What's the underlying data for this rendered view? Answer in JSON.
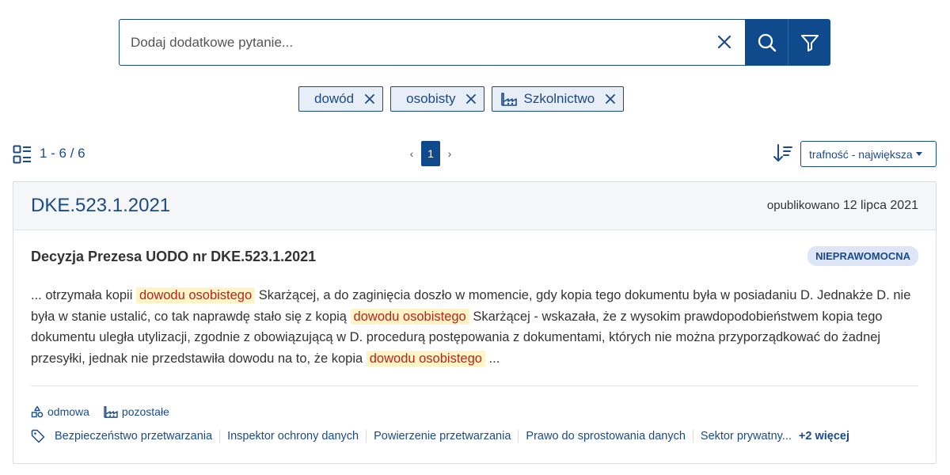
{
  "search": {
    "placeholder": "Dodaj dodatkowe pytanie...",
    "value": ""
  },
  "chips": [
    {
      "label": "dowód",
      "icon": ""
    },
    {
      "label": "osobisty",
      "icon": ""
    },
    {
      "label": "Szkolnictwo",
      "icon": "factory-icon"
    }
  ],
  "toolbar": {
    "count": "1 - 6 / 6",
    "page_prev": "‹",
    "current_page": "1",
    "page_next": "›",
    "sort_label": "trafność - największa"
  },
  "card": {
    "id": "DKE.523.1.2021",
    "published_prefix": "opublikowano",
    "published_date": "12 lipca 2021",
    "title": "Decyzja Prezesa UODO nr DKE.523.1.2021",
    "badge": "NIEPRAWOMOCNA",
    "excerpt": [
      {
        "text": "... otrzymała kopii ",
        "highlight": false
      },
      {
        "text": "dowodu osobistego",
        "highlight": true
      },
      {
        "text": " Skarżącej, a do zaginięcia doszło w momencie, gdy kopia tego dokumentu była w posiadaniu D. Jednakże D. nie była w stanie ustalić, co tak naprawdę stało się z kopią ",
        "highlight": false
      },
      {
        "text": "dowodu osobistego",
        "highlight": true
      },
      {
        "text": " Skarżącej - wskazała, że z wysokim prawdopodobieństwem kopia tego dokumentu uległa utylizacji, zgodnie z obowiązującą w D. procedurą postępowania z dokumentami, których nie można przyporządkować do żadnej przesyłki, jednak nie przedstawiła dowodu na to, że kopia ",
        "highlight": false
      },
      {
        "text": "dowodu osobistego",
        "highlight": true
      },
      {
        "text": " ...",
        "highlight": false
      }
    ],
    "meta": [
      {
        "label": "odmowa",
        "icon": "shapes-icon"
      },
      {
        "label": "pozostałe",
        "icon": "factory-icon"
      }
    ],
    "tags": [
      "Bezpieczeństwo przetwarzania",
      "Inspektor ochrony danych",
      "Powierzenie przetwarzania",
      "Prawo do sprostowania danych",
      "Sektor prywatny..."
    ],
    "more_label": "+2 więcej"
  },
  "colors": {
    "primary": "#0e4a8c",
    "link": "#1b4a8a",
    "highlight_bg": "#fff4c5",
    "highlight_text": "#b3261e",
    "badge_bg": "#dce6f6"
  }
}
